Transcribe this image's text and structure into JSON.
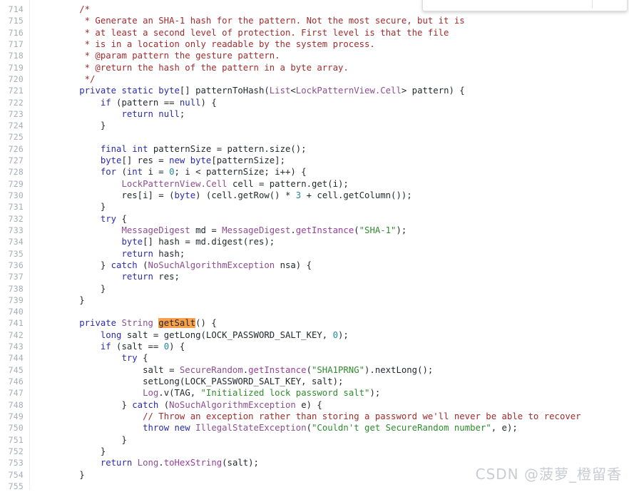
{
  "editor": {
    "language": "java",
    "first_line_number": 714,
    "last_line_number": 755,
    "highlight_token": "getSalt",
    "colors": {
      "background": "#ffffff",
      "line_number": "#a9adb3",
      "gutter_rule": "#eceff1",
      "plain": "#24292e",
      "keyword": "#2b2bb0",
      "class_name": "#8d4d90",
      "string": "#2e8b2e",
      "comment": "#a32b2b",
      "number": "#1b8a9c",
      "function": "#9b3d9b",
      "search_highlight": "#f9a14a"
    }
  },
  "float_panel": {
    "present": true,
    "text": ""
  },
  "watermark": {
    "text": "CSDN @菠萝_橙留香",
    "color": "#c9cdd1"
  },
  "code_lines": [
    {
      "n": 714,
      "tokens": [
        {
          "t": "com",
          "s": "        /*"
        }
      ]
    },
    {
      "n": 715,
      "tokens": [
        {
          "t": "com",
          "s": "         * Generate an SHA-1 hash for the pattern. Not the most secure, but it is"
        }
      ]
    },
    {
      "n": 716,
      "tokens": [
        {
          "t": "com",
          "s": "         * at least a second level of protection. First level is that the file"
        }
      ]
    },
    {
      "n": 717,
      "tokens": [
        {
          "t": "com",
          "s": "         * is in a location only readable by the system process."
        }
      ]
    },
    {
      "n": 718,
      "tokens": [
        {
          "t": "com",
          "s": "         * @param pattern the gesture pattern."
        }
      ]
    },
    {
      "n": 719,
      "tokens": [
        {
          "t": "com",
          "s": "         * @return the hash of the pattern in a byte array."
        }
      ]
    },
    {
      "n": 720,
      "tokens": [
        {
          "t": "com",
          "s": "         */"
        }
      ]
    },
    {
      "n": 721,
      "tokens": [
        {
          "t": "pln",
          "s": "        "
        },
        {
          "t": "kw",
          "s": "private static byte"
        },
        {
          "t": "pln",
          "s": "[] patternToHash("
        },
        {
          "t": "cls",
          "s": "List"
        },
        {
          "t": "pln",
          "s": "<"
        },
        {
          "t": "cls",
          "s": "LockPatternView.Cell"
        },
        {
          "t": "pln",
          "s": "> pattern) {"
        }
      ]
    },
    {
      "n": 722,
      "tokens": [
        {
          "t": "pln",
          "s": "            "
        },
        {
          "t": "kw",
          "s": "if"
        },
        {
          "t": "pln",
          "s": " (pattern == "
        },
        {
          "t": "kw",
          "s": "null"
        },
        {
          "t": "pln",
          "s": ") {"
        }
      ]
    },
    {
      "n": 723,
      "tokens": [
        {
          "t": "pln",
          "s": "                "
        },
        {
          "t": "kw",
          "s": "return null"
        },
        {
          "t": "pln",
          "s": ";"
        }
      ]
    },
    {
      "n": 724,
      "tokens": [
        {
          "t": "pln",
          "s": "            }"
        }
      ]
    },
    {
      "n": 725,
      "tokens": [
        {
          "t": "pln",
          "s": ""
        }
      ]
    },
    {
      "n": 726,
      "tokens": [
        {
          "t": "pln",
          "s": "            "
        },
        {
          "t": "kw",
          "s": "final int"
        },
        {
          "t": "pln",
          "s": " patternSize = pattern.size();"
        }
      ]
    },
    {
      "n": 727,
      "tokens": [
        {
          "t": "pln",
          "s": "            "
        },
        {
          "t": "kw",
          "s": "byte"
        },
        {
          "t": "pln",
          "s": "[] res = "
        },
        {
          "t": "kw",
          "s": "new byte"
        },
        {
          "t": "pln",
          "s": "[patternSize];"
        }
      ]
    },
    {
      "n": 728,
      "tokens": [
        {
          "t": "pln",
          "s": "            "
        },
        {
          "t": "kw",
          "s": "for"
        },
        {
          "t": "pln",
          "s": " ("
        },
        {
          "t": "kw",
          "s": "int"
        },
        {
          "t": "pln",
          "s": " i = "
        },
        {
          "t": "num",
          "s": "0"
        },
        {
          "t": "pln",
          "s": "; i < patternSize; i++) {"
        }
      ]
    },
    {
      "n": 729,
      "tokens": [
        {
          "t": "pln",
          "s": "                "
        },
        {
          "t": "cls",
          "s": "LockPatternView.Cell"
        },
        {
          "t": "pln",
          "s": " cell = pattern.get(i);"
        }
      ]
    },
    {
      "n": 730,
      "tokens": [
        {
          "t": "pln",
          "s": "                res[i] = ("
        },
        {
          "t": "kw",
          "s": "byte"
        },
        {
          "t": "pln",
          "s": ") (cell.getRow() * "
        },
        {
          "t": "num",
          "s": "3"
        },
        {
          "t": "pln",
          "s": " + cell.getColumn());"
        }
      ]
    },
    {
      "n": 731,
      "tokens": [
        {
          "t": "pln",
          "s": "            }"
        }
      ]
    },
    {
      "n": 732,
      "tokens": [
        {
          "t": "pln",
          "s": "            "
        },
        {
          "t": "kw",
          "s": "try"
        },
        {
          "t": "pln",
          "s": " {"
        }
      ]
    },
    {
      "n": 733,
      "tokens": [
        {
          "t": "pln",
          "s": "                "
        },
        {
          "t": "cls",
          "s": "MessageDigest"
        },
        {
          "t": "pln",
          "s": " md = "
        },
        {
          "t": "cls",
          "s": "MessageDigest"
        },
        {
          "t": "pln",
          "s": "."
        },
        {
          "t": "fn",
          "s": "getInstance"
        },
        {
          "t": "pln",
          "s": "("
        },
        {
          "t": "str",
          "s": "\"SHA-1\""
        },
        {
          "t": "pln",
          "s": ");"
        }
      ]
    },
    {
      "n": 734,
      "tokens": [
        {
          "t": "pln",
          "s": "                "
        },
        {
          "t": "kw",
          "s": "byte"
        },
        {
          "t": "pln",
          "s": "[] hash = md.digest(res);"
        }
      ]
    },
    {
      "n": 735,
      "tokens": [
        {
          "t": "pln",
          "s": "                "
        },
        {
          "t": "kw",
          "s": "return"
        },
        {
          "t": "pln",
          "s": " hash;"
        }
      ]
    },
    {
      "n": 736,
      "tokens": [
        {
          "t": "pln",
          "s": "            } "
        },
        {
          "t": "kw",
          "s": "catch"
        },
        {
          "t": "pln",
          "s": " ("
        },
        {
          "t": "cls",
          "s": "NoSuchAlgorithmException"
        },
        {
          "t": "pln",
          "s": " nsa) {"
        }
      ]
    },
    {
      "n": 737,
      "tokens": [
        {
          "t": "pln",
          "s": "                "
        },
        {
          "t": "kw",
          "s": "return"
        },
        {
          "t": "pln",
          "s": " res;"
        }
      ]
    },
    {
      "n": 738,
      "tokens": [
        {
          "t": "pln",
          "s": "            }"
        }
      ]
    },
    {
      "n": 739,
      "tokens": [
        {
          "t": "pln",
          "s": "        }"
        }
      ]
    },
    {
      "n": 740,
      "tokens": [
        {
          "t": "pln",
          "s": ""
        }
      ]
    },
    {
      "n": 741,
      "tokens": [
        {
          "t": "pln",
          "s": "        "
        },
        {
          "t": "kw",
          "s": "private"
        },
        {
          "t": "pln",
          "s": " "
        },
        {
          "t": "cls",
          "s": "String"
        },
        {
          "t": "pln",
          "s": " "
        },
        {
          "t": "hl",
          "s": "getSalt"
        },
        {
          "t": "pln",
          "s": "() {"
        }
      ]
    },
    {
      "n": 742,
      "tokens": [
        {
          "t": "pln",
          "s": "            "
        },
        {
          "t": "kw",
          "s": "long"
        },
        {
          "t": "pln",
          "s": " salt = getLong(LOCK_PASSWORD_SALT_KEY, "
        },
        {
          "t": "num",
          "s": "0"
        },
        {
          "t": "pln",
          "s": ");"
        }
      ]
    },
    {
      "n": 743,
      "tokens": [
        {
          "t": "pln",
          "s": "            "
        },
        {
          "t": "kw",
          "s": "if"
        },
        {
          "t": "pln",
          "s": " (salt == "
        },
        {
          "t": "num",
          "s": "0"
        },
        {
          "t": "pln",
          "s": ") {"
        }
      ]
    },
    {
      "n": 744,
      "tokens": [
        {
          "t": "pln",
          "s": "                "
        },
        {
          "t": "kw",
          "s": "try"
        },
        {
          "t": "pln",
          "s": " {"
        }
      ]
    },
    {
      "n": 745,
      "tokens": [
        {
          "t": "pln",
          "s": "                    salt = "
        },
        {
          "t": "cls",
          "s": "SecureRandom"
        },
        {
          "t": "pln",
          "s": "."
        },
        {
          "t": "fn",
          "s": "getInstance"
        },
        {
          "t": "pln",
          "s": "("
        },
        {
          "t": "str",
          "s": "\"SHA1PRNG\""
        },
        {
          "t": "pln",
          "s": ").nextLong();"
        }
      ]
    },
    {
      "n": 746,
      "tokens": [
        {
          "t": "pln",
          "s": "                    setLong(LOCK_PASSWORD_SALT_KEY, salt);"
        }
      ]
    },
    {
      "n": 747,
      "tokens": [
        {
          "t": "pln",
          "s": "                    "
        },
        {
          "t": "cls",
          "s": "Log"
        },
        {
          "t": "pln",
          "s": ".v(TAG, "
        },
        {
          "t": "str",
          "s": "\"Initialized lock password salt\""
        },
        {
          "t": "pln",
          "s": ");"
        }
      ]
    },
    {
      "n": 748,
      "tokens": [
        {
          "t": "pln",
          "s": "                } "
        },
        {
          "t": "kw",
          "s": "catch"
        },
        {
          "t": "pln",
          "s": " ("
        },
        {
          "t": "cls",
          "s": "NoSuchAlgorithmException"
        },
        {
          "t": "pln",
          "s": " e) {"
        }
      ]
    },
    {
      "n": 749,
      "tokens": [
        {
          "t": "pln",
          "s": "                    "
        },
        {
          "t": "com",
          "s": "// Throw an exception rather than storing a password we'll never be able to recover"
        }
      ]
    },
    {
      "n": 750,
      "tokens": [
        {
          "t": "pln",
          "s": "                    "
        },
        {
          "t": "kw",
          "s": "throw new"
        },
        {
          "t": "pln",
          "s": " "
        },
        {
          "t": "cls",
          "s": "IllegalStateException"
        },
        {
          "t": "pln",
          "s": "("
        },
        {
          "t": "str",
          "s": "\"Couldn't get SecureRandom number\""
        },
        {
          "t": "pln",
          "s": ", e);"
        }
      ]
    },
    {
      "n": 751,
      "tokens": [
        {
          "t": "pln",
          "s": "                }"
        }
      ]
    },
    {
      "n": 752,
      "tokens": [
        {
          "t": "pln",
          "s": "            }"
        }
      ]
    },
    {
      "n": 753,
      "tokens": [
        {
          "t": "pln",
          "s": "            "
        },
        {
          "t": "kw",
          "s": "return"
        },
        {
          "t": "pln",
          "s": " "
        },
        {
          "t": "cls",
          "s": "Long"
        },
        {
          "t": "pln",
          "s": "."
        },
        {
          "t": "fn",
          "s": "toHexString"
        },
        {
          "t": "pln",
          "s": "(salt);"
        }
      ]
    },
    {
      "n": 754,
      "tokens": [
        {
          "t": "pln",
          "s": "        }"
        }
      ]
    },
    {
      "n": 755,
      "tokens": [
        {
          "t": "pln",
          "s": ""
        }
      ]
    }
  ]
}
